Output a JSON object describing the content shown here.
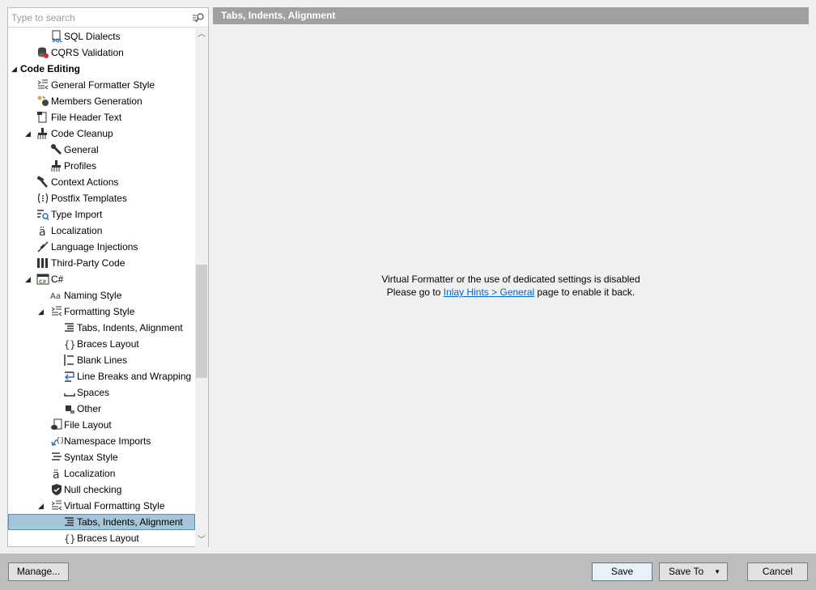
{
  "search": {
    "placeholder": "Type to search"
  },
  "header": {
    "title": "Tabs, Indents, Alignment"
  },
  "message": {
    "line1": "Virtual Formatter or the use of dedicated settings is disabled",
    "line2_prefix": "Please go to ",
    "link": "Inlay Hints > General",
    "line2_suffix": " page to enable it back."
  },
  "tree": [
    {
      "label": "SQL Dialects",
      "icon": "sql-icon"
    },
    {
      "label": "CQRS Validation",
      "icon": "cqrs-icon"
    },
    {
      "label": "Code Editing",
      "expanded": true
    },
    {
      "label": "General Formatter Style",
      "icon": "formatter-style-icon"
    },
    {
      "label": "Members Generation",
      "icon": "members-generation-icon"
    },
    {
      "label": "File Header Text",
      "icon": "file-header-icon"
    },
    {
      "label": "Code Cleanup",
      "icon": "broom-icon",
      "expanded": true
    },
    {
      "label": "General",
      "icon": "wrench-icon"
    },
    {
      "label": "Profiles",
      "icon": "broom-icon"
    },
    {
      "label": "Context Actions",
      "icon": "hammer-icon"
    },
    {
      "label": "Postfix Templates",
      "icon": "postfix-icon"
    },
    {
      "label": "Type Import",
      "icon": "type-import-icon"
    },
    {
      "label": "Localization",
      "icon": "localization-icon"
    },
    {
      "label": "Language Injections",
      "icon": "injection-icon"
    },
    {
      "label": "Third-Party Code",
      "icon": "third-party-icon"
    },
    {
      "label": "C#",
      "icon": "csharp-icon",
      "expanded": true
    },
    {
      "label": "Naming Style",
      "icon": "naming-style-icon"
    },
    {
      "label": "Formatting Style",
      "icon": "formatter-style-icon",
      "expanded": true
    },
    {
      "label": "Tabs, Indents, Alignment",
      "icon": "tabs-indents-icon"
    },
    {
      "label": "Braces Layout",
      "icon": "braces-icon"
    },
    {
      "label": "Blank Lines",
      "icon": "blank-lines-icon"
    },
    {
      "label": "Line Breaks and Wrapping",
      "icon": "line-breaks-icon"
    },
    {
      "label": "Spaces",
      "icon": "spaces-icon"
    },
    {
      "label": "Other",
      "icon": "other-icon"
    },
    {
      "label": "File Layout",
      "icon": "file-layout-icon"
    },
    {
      "label": "Namespace Imports",
      "icon": "namespace-imports-icon"
    },
    {
      "label": "Syntax Style",
      "icon": "syntax-style-icon"
    },
    {
      "label": "Localization",
      "icon": "localization-icon"
    },
    {
      "label": "Null checking",
      "icon": "shield-icon"
    },
    {
      "label": "Virtual Formatting Style",
      "icon": "formatter-style-icon",
      "expanded": true
    },
    {
      "label": "Tabs, Indents, Alignment",
      "icon": "tabs-indents-icon",
      "selected": true
    },
    {
      "label": "Braces Layout",
      "icon": "braces-icon"
    }
  ],
  "buttons": {
    "manage": "Manage...",
    "save": "Save",
    "save_to": "Save To",
    "cancel": "Cancel"
  },
  "colors": {
    "header_bg": "#a0a0a0",
    "selection_bg": "#a5c6d8",
    "link": "#0066cc",
    "bottom_bar": "#bdbdbd"
  }
}
